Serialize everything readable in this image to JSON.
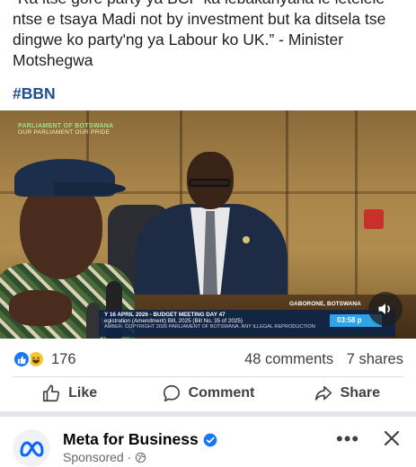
{
  "post": {
    "text_line1": "“Ra itse gore party ya BCP ka lebakanyana le letelele",
    "text_line2": "ntse e tsaya Madi not by investment but ka ditsela tse",
    "text_line3": "dingwe ko party'ng ya Labour ko UK.” - Minister",
    "text_line4": "Motshegwa",
    "hashtag": "#BBN"
  },
  "video": {
    "channel_line1": "PARLIAMENT OF BOTSWANA",
    "channel_line2": "OUR PARLIAMENT OUR PRIDE",
    "location": "GABORONE, BOTSWANA",
    "ticker_line1": "Y 16 APRIL 2026 - BUDGET MEETING DAY 47",
    "ticker_line2": "egistration (Amendment) Bill, 2025 (Bill No. 35 of 2025)",
    "ticker_line3": "AMBER. COPYRIGHT 2026 PARLIAMENT OF BOTSWANA. ANY ILLEGAL REPRODUCTION",
    "clock": "03:58 p",
    "sound_icon": "speaker-icon"
  },
  "engagement": {
    "reaction_count": "176",
    "comments": "48 comments",
    "shares": "7 shares"
  },
  "actions": {
    "like": "Like",
    "comment": "Comment",
    "share": "Share"
  },
  "next_post": {
    "author": "Meta for Business",
    "subtitle": "Sponsored ·",
    "more": "•••"
  },
  "colors": {
    "accent": "#1877f2",
    "text_secondary": "#65676b",
    "hashtag": "#1f4e8c"
  }
}
